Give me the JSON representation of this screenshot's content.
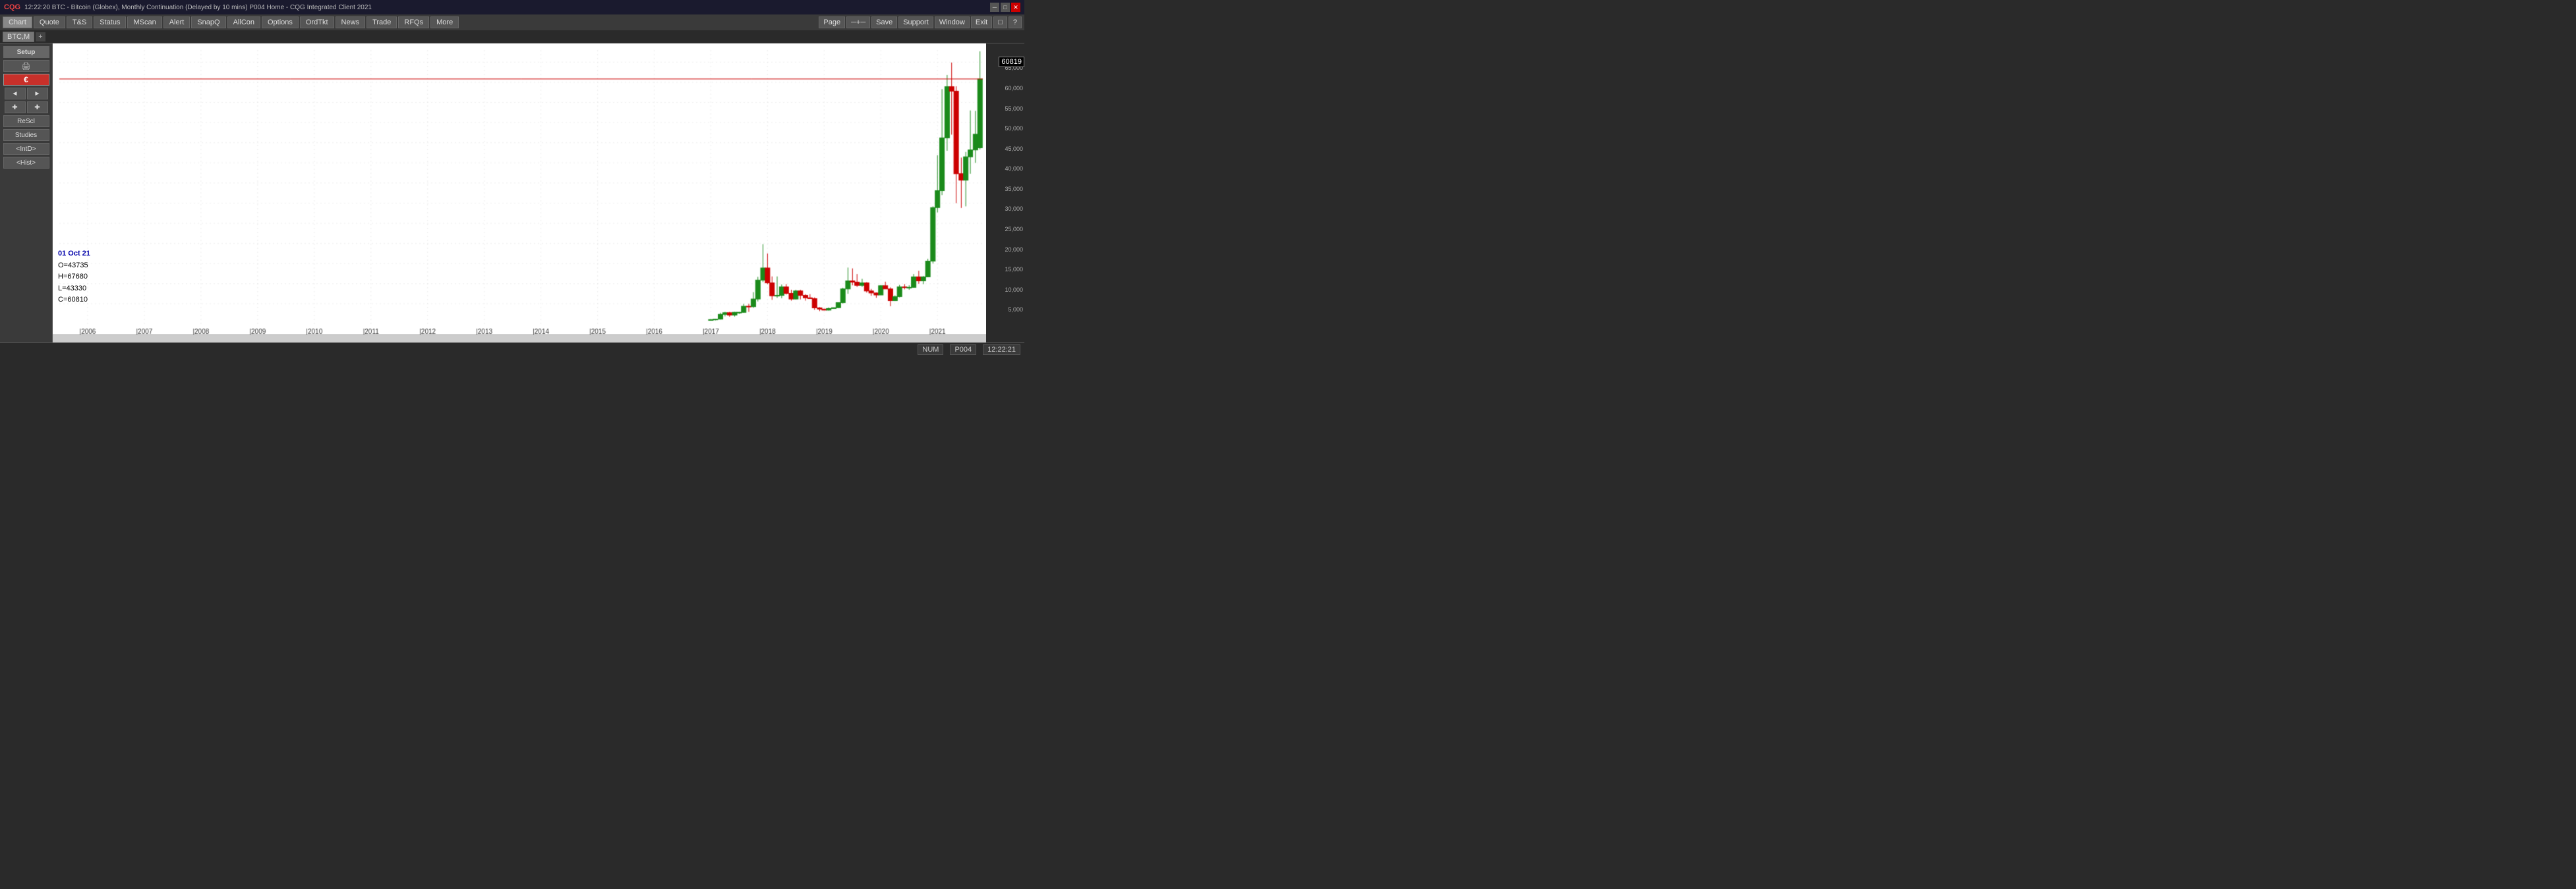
{
  "titlebar": {
    "logo": "CQG",
    "title": "12:22:20  BTC - Bitcoin (Globex), Monthly Continuation (Delayed by 10 mins)  P004 Home - CQG Integrated Client 2021",
    "minimize": "─",
    "maximize": "□",
    "close": "✕"
  },
  "menubar": {
    "left": [
      {
        "label": "Chart",
        "active": true
      },
      {
        "label": "Quote"
      },
      {
        "label": "T&S"
      },
      {
        "label": "Status"
      },
      {
        "label": "MScan"
      },
      {
        "label": "Alert"
      },
      {
        "label": "SnapQ"
      },
      {
        "label": "AllCon"
      },
      {
        "label": "Options"
      },
      {
        "label": "OrdTkt"
      },
      {
        "label": "News"
      },
      {
        "label": "Trade"
      },
      {
        "label": "RFQs"
      },
      {
        "label": "More"
      }
    ],
    "right": [
      {
        "label": "Page"
      },
      {
        "label": "─+─"
      },
      {
        "label": "Save"
      },
      {
        "label": "Support"
      },
      {
        "label": "Window"
      },
      {
        "label": "Exit"
      },
      {
        "label": "□"
      },
      {
        "label": "?"
      }
    ]
  },
  "tabs": [
    {
      "label": "BTC,M",
      "active": true
    },
    {
      "label": "+"
    }
  ],
  "sidebar": {
    "setup_label": "Setup",
    "print_icon": "🖨",
    "euro_icon": "€",
    "btn1a": "◄",
    "btn1b": "►",
    "btn2a": "✚",
    "btn2b": "✚",
    "rescl_label": "ReScl",
    "studies_label": "Studies",
    "intd_label": "<IntD>",
    "hist_label": "<Hist>"
  },
  "chart": {
    "symbol": "BTC,M",
    "years": [
      "2006",
      "2007",
      "2008",
      "2009",
      "2010",
      "2011",
      "2012",
      "2013",
      "2014",
      "2015",
      "2016",
      "2017",
      "2018",
      "2019",
      "2020",
      "2021"
    ],
    "price_levels": [
      5000,
      10000,
      15000,
      20000,
      25000,
      30000,
      35000,
      40000,
      45000,
      50000,
      55000,
      60000,
      65000
    ],
    "current_price": "60819",
    "ohlc": {
      "date": "01 Oct 21",
      "open_label": "O=",
      "open_val": "43735",
      "high_label": "H=",
      "high_val": "67680",
      "low_label": "L=",
      "low_val": "43330",
      "close_label": "C=",
      "close_val": "60810"
    }
  },
  "statusbar": {
    "num": "NUM",
    "page": "P004",
    "time": "12:22:21"
  }
}
